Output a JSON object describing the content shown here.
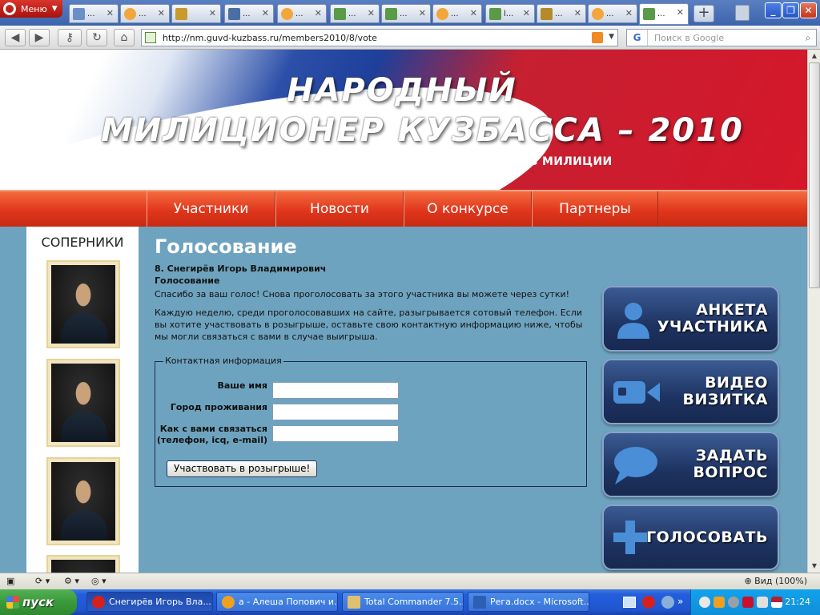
{
  "browser": {
    "menu_label": "Меню",
    "tabs": [
      {
        "label": "...",
        "color": "#6a8fc7"
      },
      {
        "label": "...",
        "color": "#f3a63b"
      },
      {
        "label": "",
        "color": "#c89a2e"
      },
      {
        "label": "...",
        "color": "#4b6fa5"
      },
      {
        "label": "...",
        "color": "#f3a63b"
      },
      {
        "label": "...",
        "color": "#5a9a48"
      },
      {
        "label": "...",
        "color": "#5a9a48"
      },
      {
        "label": "...",
        "color": "#f3a63b"
      },
      {
        "label": "l...",
        "color": "#5a9a48"
      },
      {
        "label": "...",
        "color": "#b58a2a"
      },
      {
        "label": "...",
        "color": "#f3a63b"
      },
      {
        "label": "...",
        "color": "#5a9a48"
      }
    ],
    "url": "http://nm.guvd-kuzbass.ru/members2010/8/vote",
    "search_placeholder": "Поиск в Google",
    "search_engine": "G",
    "zoom_label": "Вид (100%)"
  },
  "banner": {
    "title_line1": "НАРОДНЫЙ",
    "title_line2": "МИЛИЦИОНЕР КУЗБАССА – 2010",
    "subtitle": "ВСЕКУЗБАССКИЙ КОНКУРС СОТРУДНИКОВ МИЛИЦИИ"
  },
  "nav": {
    "items": [
      "Участники",
      "Новости",
      "О конкурсе",
      "Партнеры"
    ]
  },
  "sidebar": {
    "heading": "СОПЕРНИКИ"
  },
  "main": {
    "title": "Голосование",
    "member": "8. Снегирёв Игорь Владимирович",
    "section": "Голосование",
    "thanks": "Спасибо за ваш голос! Снова проголосовать за этого участника вы можете через сутки!",
    "info": "Каждую неделю, среди проголосовавших на сайте, разыгрывается сотовый телефон. Если вы хотите участвовать в розыгрыше, оставьте свою контактную информацию ниже, чтобы мы могли связаться с вами в случае выигрыша."
  },
  "form": {
    "legend": "Контактная информация",
    "name_label": "Ваше имя",
    "city_label": "Город проживания",
    "contact_label_1": "Как с вами связаться",
    "contact_label_2": "(телефон, icq, e-mail)",
    "submit_label": "Участвовать в розыгрыше!"
  },
  "actions": {
    "profile_1": "АНКЕТА",
    "profile_2": "УЧАСТНИКА",
    "video_1": "ВИДЕО",
    "video_2": "ВИЗИТКА",
    "ask_1": "ЗАДАТЬ",
    "ask_2": "ВОПРОС",
    "vote": "ГОЛОСОВАТЬ"
  },
  "taskbar": {
    "start_label": "пуск",
    "tasks": [
      "Снегирёв Игорь Вла...",
      "а - Алеша Попович и...",
      "Total Commander 7.5...",
      "Рега.docx - Microsoft..."
    ],
    "clock": "21:24"
  },
  "colors": {
    "page_bg": "#6ea3bf",
    "nav_orange": "#e0361c",
    "button_navy": "#1e3361"
  }
}
